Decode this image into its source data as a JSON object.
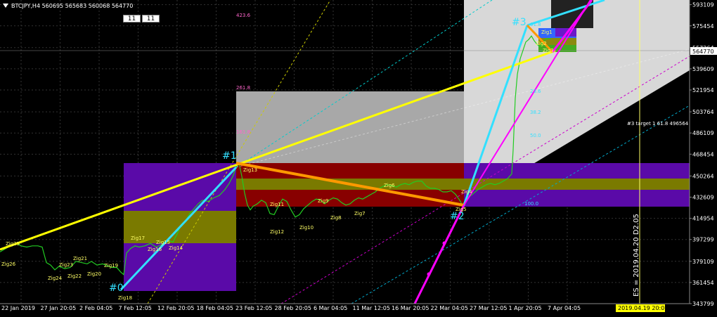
{
  "header": {
    "symbol_line": "BTCJPY,H4  560695 565683 560068 564770",
    "buttons": [
      "11",
      "11"
    ]
  },
  "price_tag": "564770",
  "date_tag": "2019.04.19 20:05",
  "es_label": "ES = 2019.04.20 D2.05",
  "target_label": "#3 target 1 61.8 496564",
  "fib_label_lower": "100.0",
  "colors": {
    "background": "#000000",
    "grid": "#2a2a2a",
    "price": "#22cc22",
    "yellow_line": "#ffff00",
    "cyan_line": "#33e0ff",
    "orange_line": "#ff9900",
    "magenta_line": "#ff00ff",
    "purple_zone": "#5a0aa8",
    "olive_zone": "#7a7a00",
    "red_zone": "#880000",
    "gray_zone": "#a8a8a8",
    "light_zone": "#d8d8d8"
  },
  "chart_data": {
    "type": "line",
    "title": "BTCJPY,H4",
    "y_axis_labels": [
      "593109",
      "575454",
      "557264",
      "539609",
      "521954",
      "503764",
      "486109",
      "468454",
      "450264",
      "432609",
      "414954",
      "397299",
      "379109",
      "361454",
      "343799"
    ],
    "ylim": [
      343799,
      597000
    ],
    "x_axis_labels": [
      "22 Jan 2019",
      "27 Jan 20:05",
      "2 Feb 04:05",
      "7 Feb 12:05",
      "12 Feb 20:05",
      "18 Feb 04:05",
      "23 Feb 12:05",
      "28 Feb 20:05",
      "6 Mar 04:05",
      "11 Mar 12:05",
      "16 Mar 20:05",
      "22 Mar 04:05",
      "27 Mar 12:05",
      "1 Apr 20:05",
      "7 Apr 04:05"
    ],
    "series": [
      {
        "values": [
          [
            0,
            387000
          ],
          [
            6,
            389000
          ],
          [
            12,
            391000
          ],
          [
            18,
            393000
          ],
          [
            24,
            394000
          ],
          [
            30,
            392000
          ],
          [
            38,
            391000
          ],
          [
            46,
            392000
          ],
          [
            54,
            392000
          ],
          [
            60,
            391000
          ],
          [
            66,
            378000
          ],
          [
            72,
            376000
          ],
          [
            78,
            372000
          ],
          [
            84,
            375000
          ],
          [
            92,
            373000
          ],
          [
            100,
            374000
          ],
          [
            108,
            379000
          ],
          [
            116,
            378000
          ],
          [
            124,
            377000
          ],
          [
            130,
            379000
          ],
          [
            138,
            376000
          ],
          [
            146,
            377000
          ],
          [
            154,
            375000
          ],
          [
            160,
            374000
          ],
          [
            166,
            374000
          ],
          [
            172,
            370000
          ],
          [
            176,
            368000
          ],
          [
            180,
            386000
          ],
          [
            186,
            390000
          ],
          [
            192,
            392000
          ],
          [
            198,
            391000
          ],
          [
            206,
            392000
          ],
          [
            214,
            394000
          ],
          [
            222,
            391000
          ],
          [
            230,
            393000
          ],
          [
            238,
            397000
          ],
          [
            246,
            395000
          ],
          [
            252,
            402000
          ],
          [
            258,
            410000
          ],
          [
            264,
            413000
          ],
          [
            270,
            419000
          ],
          [
            276,
            423000
          ],
          [
            282,
            427000
          ],
          [
            288,
            430000
          ],
          [
            296,
            429000
          ],
          [
            304,
            432000
          ],
          [
            312,
            434000
          ],
          [
            320,
            439000
          ],
          [
            326,
            444000
          ],
          [
            332,
            451000
          ],
          [
            336,
            458000
          ],
          [
            340,
            461000
          ],
          [
            344,
            450000
          ],
          [
            348,
            436000
          ],
          [
            352,
            426000
          ],
          [
            356,
            422000
          ],
          [
            360,
            425000
          ],
          [
            366,
            427000
          ],
          [
            372,
            430000
          ],
          [
            378,
            428000
          ],
          [
            384,
            419000
          ],
          [
            390,
            418000
          ],
          [
            396,
            425000
          ],
          [
            402,
            431000
          ],
          [
            408,
            429000
          ],
          [
            414,
            422000
          ],
          [
            420,
            416000
          ],
          [
            426,
            418000
          ],
          [
            432,
            423000
          ],
          [
            438,
            426000
          ],
          [
            444,
            429000
          ],
          [
            450,
            431000
          ],
          [
            456,
            430000
          ],
          [
            462,
            427000
          ],
          [
            468,
            430000
          ],
          [
            474,
            432000
          ],
          [
            480,
            431000
          ],
          [
            486,
            428000
          ],
          [
            492,
            426000
          ],
          [
            498,
            427000
          ],
          [
            504,
            430000
          ],
          [
            510,
            432000
          ],
          [
            516,
            431000
          ],
          [
            522,
            433000
          ],
          [
            528,
            435000
          ],
          [
            534,
            437000
          ],
          [
            540,
            440000
          ],
          [
            546,
            442000
          ],
          [
            552,
            443000
          ],
          [
            558,
            442000
          ],
          [
            564,
            441000
          ],
          [
            570,
            443000
          ],
          [
            576,
            444000
          ],
          [
            582,
            443000
          ],
          [
            588,
            445000
          ],
          [
            594,
            446000
          ],
          [
            600,
            446000
          ],
          [
            606,
            442000
          ],
          [
            612,
            440000
          ],
          [
            618,
            440000
          ],
          [
            624,
            439000
          ],
          [
            630,
            437000
          ],
          [
            636,
            437000
          ],
          [
            642,
            438000
          ],
          [
            648,
            435000
          ],
          [
            654,
            430000
          ],
          [
            658,
            426000
          ],
          [
            662,
            430000
          ],
          [
            668,
            433000
          ],
          [
            674,
            436000
          ],
          [
            680,
            439000
          ],
          [
            686,
            441000
          ],
          [
            692,
            443000
          ],
          [
            698,
            444000
          ],
          [
            704,
            443000
          ],
          [
            710,
            444000
          ],
          [
            716,
            446000
          ],
          [
            722,
            448000
          ],
          [
            728,
            452000
          ],
          [
            730,
            472000
          ],
          [
            733,
            515000
          ],
          [
            736,
            535000
          ],
          [
            740,
            548000
          ],
          [
            744,
            555000
          ],
          [
            748,
            562000
          ],
          [
            752,
            564000
          ],
          [
            756,
            567000
          ],
          [
            760,
            563000
          ],
          [
            764,
            560000
          ],
          [
            768,
            558000
          ],
          [
            772,
            562000
          ],
          [
            776,
            564000
          ],
          [
            780,
            565000
          ],
          [
            784,
            564770
          ]
        ]
      }
    ],
    "zigzag_labels": [
      "Zig25",
      "Zig26",
      "Zig24",
      "Zig23",
      "Zig22",
      "Zig21",
      "Zig20",
      "Zig19",
      "Zig18",
      "Zig17",
      "Zig16",
      "Zig15",
      "Zig14",
      "Zig13",
      "Zig12",
      "Zig11",
      "Zig10",
      "Zig9",
      "Zig8",
      "Zig7",
      "Zig6",
      "Zig5",
      "Zig4",
      "Zig3",
      "Zig2",
      "Zig1"
    ],
    "point_labels": [
      "#0",
      "#1",
      "#2",
      "#3"
    ],
    "fib_levels": [
      "423.6",
      "261.8",
      "161.8",
      "23.6",
      "38.2",
      "50.0",
      "61.8"
    ]
  }
}
